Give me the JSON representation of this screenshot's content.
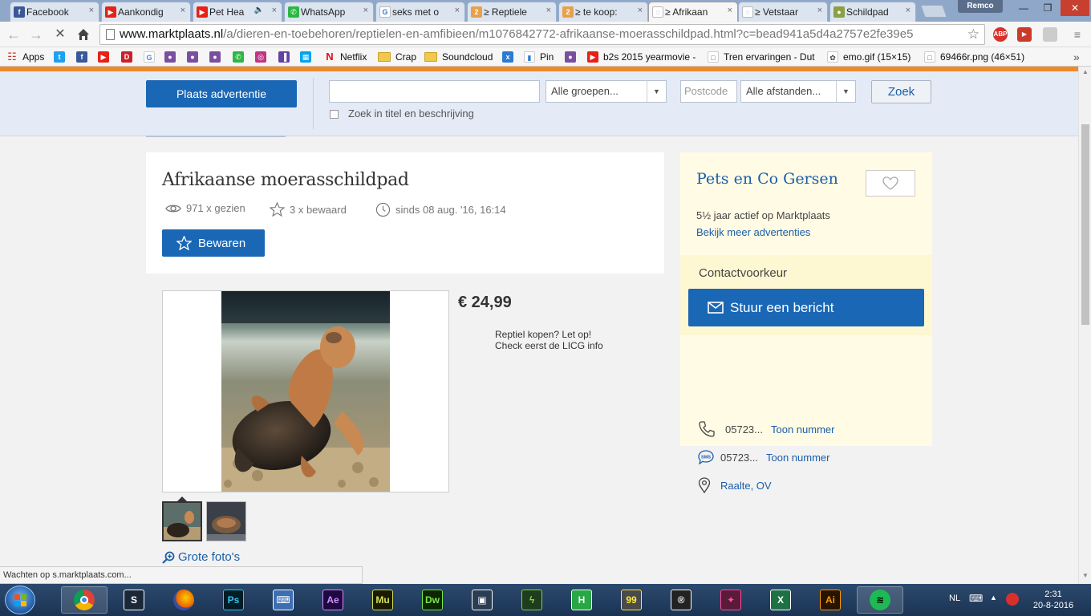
{
  "browser": {
    "tabs": [
      {
        "title": "Facebook",
        "icon": "facebook-icon",
        "color": "#3b5998",
        "glyph": "f"
      },
      {
        "title": "Aankondig",
        "icon": "youtube-icon",
        "color": "#e62117",
        "glyph": "▶"
      },
      {
        "title": "Pet Hea",
        "icon": "youtube-icon",
        "color": "#e62117",
        "glyph": "▶",
        "audio": true
      },
      {
        "title": "WhatsApp",
        "icon": "whatsapp-icon",
        "color": "#2cb742",
        "glyph": "✆"
      },
      {
        "title": "seks met o",
        "icon": "google-icon",
        "color": "#ffffff",
        "glyph": "G"
      },
      {
        "title": "≥ Reptiele",
        "icon": "marktplaats-icon",
        "color": "#e8a04a",
        "glyph": "2"
      },
      {
        "title": "≥ te koop:",
        "icon": "marktplaats-icon",
        "color": "#e8a04a",
        "glyph": "2"
      },
      {
        "title": "≥ Afrikaan",
        "icon": "loading-icon",
        "color": "#ffffff",
        "glyph": "◌",
        "active": true
      },
      {
        "title": "≥ Vetstaar",
        "icon": "loading-icon",
        "color": "#ffffff",
        "glyph": "◌"
      },
      {
        "title": "Schildpad",
        "icon": "turtle-site-icon",
        "color": "#8aa043",
        "glyph": "●"
      }
    ],
    "profile_name": "Remco",
    "url_main": "www.marktplaats.nl",
    "url_rest": "/a/dieren-en-toebehoren/reptielen-en-amfibieen/m1076842772-afrikaanse-moerasschildpad.html?c=bead941a5d4a2757e2fe39e5",
    "bookmarks": [
      {
        "label": "Apps",
        "icon": "apps-grid-icon"
      },
      {
        "label": "",
        "icon": "twitter-icon"
      },
      {
        "label": "",
        "icon": "facebook-icon"
      },
      {
        "label": "",
        "icon": "youtube-icon"
      },
      {
        "label": "",
        "icon": "dumpert-icon"
      },
      {
        "label": "",
        "icon": "google-icon"
      },
      {
        "label": "",
        "icon": "app-icon"
      },
      {
        "label": "",
        "icon": "app-icon"
      },
      {
        "label": "",
        "icon": "app-icon"
      },
      {
        "label": "",
        "icon": "whatsapp-icon"
      },
      {
        "label": "",
        "icon": "instagram-icon"
      },
      {
        "label": "",
        "icon": "twitch-icon"
      },
      {
        "label": "",
        "icon": "windows-icon"
      },
      {
        "label": "Netflix",
        "icon": "netflix-icon"
      },
      {
        "label": "Crap",
        "icon": "folder-icon"
      },
      {
        "label": "Soundcloud",
        "icon": "folder-icon"
      },
      {
        "label": "",
        "icon": "x-icon"
      },
      {
        "label": "Pin",
        "icon": "pin-icon"
      },
      {
        "label": "",
        "icon": "app-icon"
      },
      {
        "label": "b2s 2015 yearmovie -",
        "icon": "youtube-icon"
      },
      {
        "label": "Tren ervaringen - Dut",
        "icon": "page-icon"
      },
      {
        "label": "emo.gif (15×15)",
        "icon": "image-icon"
      },
      {
        "label": "69466r.png (46×51)",
        "icon": "page-icon"
      }
    ],
    "status_text": "Wachten op s.marktplaats.com..."
  },
  "site": {
    "place_ad_label": "Plaats advertentie",
    "search_value": "",
    "groups_select": "Alle groepen...",
    "postcode_placeholder": "Postcode",
    "distance_select": "Alle afstanden...",
    "search_button": "Zoek",
    "title_desc_label": "Zoek in titel en beschrijving"
  },
  "listing": {
    "title": "Afrikaanse moerasschildpad",
    "views": "971 x gezien",
    "saved": "3 x bewaard",
    "since": "sinds 08 aug. '16, 16:14",
    "save_button": "Bewaren",
    "price": "€ 24,99",
    "note_line1": "Reptiel kopen? Let op!",
    "note_line2": "Check eerst de LICG info",
    "big_photos_link": "Grote foto's"
  },
  "seller": {
    "name": "Pets en Co Gersen",
    "active": "5½ jaar actief op Marktplaats",
    "more_ads": "Bekijk meer advertenties",
    "contact_heading": "Contactvoorkeur",
    "message_button": "Stuur een bericht",
    "phone": "05723...",
    "phone_link": "Toon nummer",
    "sms": "05723...",
    "sms_link": "Toon nummer",
    "location": "Raalte, OV"
  },
  "taskbar": {
    "language": "NL",
    "time": "2:31",
    "date": "20-8-2016",
    "apps": [
      {
        "name": "chrome-taskbar-icon",
        "glyph": "",
        "bg": "#ffffff",
        "fg": "#000",
        "active": true
      },
      {
        "name": "steam-taskbar-icon",
        "glyph": "S",
        "bg": "#1b2838",
        "fg": "#fff"
      },
      {
        "name": "firefox-taskbar-icon",
        "glyph": "",
        "bg": "#e66000",
        "fg": "#fff"
      },
      {
        "name": "photoshop-taskbar-icon",
        "glyph": "Ps",
        "bg": "#001d26",
        "fg": "#31c5f0"
      },
      {
        "name": "keyboard-taskbar-icon",
        "glyph": "⌨",
        "bg": "#3c6eb4",
        "fg": "#fff"
      },
      {
        "name": "after-effects-taskbar-icon",
        "glyph": "Ae",
        "bg": "#1f0740",
        "fg": "#d291ff"
      },
      {
        "name": "muse-taskbar-icon",
        "glyph": "Mu",
        "bg": "#1a1a00",
        "fg": "#d4e157"
      },
      {
        "name": "dreamweaver-taskbar-icon",
        "glyph": "Dw",
        "bg": "#0b2600",
        "fg": "#7be84a"
      },
      {
        "name": "movie-maker-taskbar-icon",
        "glyph": "▣",
        "bg": "#2a3d52",
        "fg": "#fff"
      },
      {
        "name": "fl-studio-taskbar-icon",
        "glyph": "ϟ",
        "bg": "#1d3d1d",
        "fg": "#8cd147"
      },
      {
        "name": "hma-taskbar-icon",
        "glyph": "H",
        "bg": "#28a745",
        "fg": "#fff"
      },
      {
        "name": "monitor-taskbar-icon",
        "glyph": "99",
        "bg": "#4a4a4a",
        "fg": "#ffeb3b"
      },
      {
        "name": "rockstar-taskbar-icon",
        "glyph": "®",
        "bg": "#222",
        "fg": "#fff"
      },
      {
        "name": "game-taskbar-icon",
        "glyph": "✦",
        "bg": "#5b1a3a",
        "fg": "#ff4f9a"
      },
      {
        "name": "excel-taskbar-icon",
        "glyph": "X",
        "bg": "#1e7145",
        "fg": "#fff"
      },
      {
        "name": "illustrator-taskbar-icon",
        "glyph": "Ai",
        "bg": "#261300",
        "fg": "#ff9a00"
      },
      {
        "name": "spotify-taskbar-icon",
        "glyph": "≋",
        "bg": "#1db954",
        "fg": "#000",
        "active": true
      }
    ]
  }
}
